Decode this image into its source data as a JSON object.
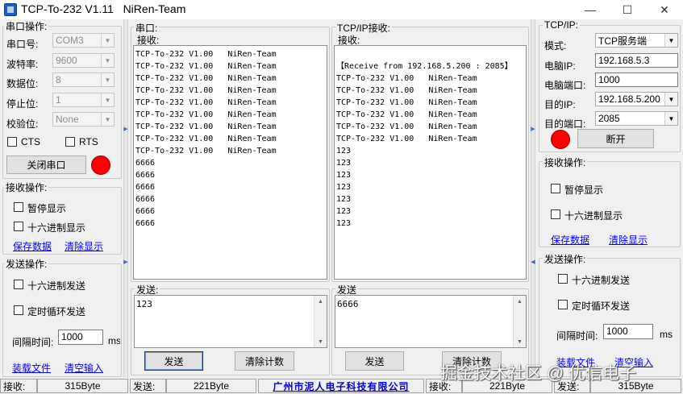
{
  "window": {
    "title": "TCP-To-232 V1.11   NiRen-Team",
    "min": "—",
    "max": "☐",
    "close": "✕"
  },
  "serial": {
    "group_label": "串口操作:",
    "port_label": "串口号:",
    "port_value": "COM3",
    "baud_label": "波特率:",
    "baud_value": "9600",
    "databits_label": "数据位:",
    "databits_value": "8",
    "stopbits_label": "停止位:",
    "stopbits_value": "1",
    "parity_label": "校验位:",
    "parity_value": "None",
    "cts_label": "CTS",
    "rts_label": "RTS",
    "close_port": "关闭串口"
  },
  "recv_ops_left": {
    "group_label": "接收操作:",
    "pause": "暂停显示",
    "hex_display": "十六进制显示",
    "save": "保存数据",
    "clear": "清除显示"
  },
  "send_ops_left": {
    "group_label": "发送操作:",
    "hex_send": "十六进制发送",
    "timed_send": "定时循环发送",
    "interval_label": "间隔时间:",
    "interval_value": "1000",
    "ms": "ms",
    "load_file": "装载文件",
    "clear_input": "清空输入"
  },
  "serial_pane": {
    "title": "串口:",
    "recv_label": "接收:",
    "recv_text": "TCP-To-232 V1.00   NiRen-Team\nTCP-To-232 V1.00   NiRen-Team\nTCP-To-232 V1.00   NiRen-Team\nTCP-To-232 V1.00   NiRen-Team\nTCP-To-232 V1.00   NiRen-Team\nTCP-To-232 V1.00   NiRen-Team\nTCP-To-232 V1.00   NiRen-Team\nTCP-To-232 V1.00   NiRen-Team\nTCP-To-232 V1.00   NiRen-Team\n6666\n6666\n6666\n6666\n6666\n6666",
    "send_label": "发送:",
    "send_text": "123",
    "send_btn": "发送",
    "clear_count_btn": "清除计数"
  },
  "tcp_pane": {
    "title": "TCP/IP接收:",
    "recv_label": "接收:",
    "recv_text": "\n【Receive from 192.168.5.200 : 2085】\nTCP-To-232 V1.00   NiRen-Team\nTCP-To-232 V1.00   NiRen-Team\nTCP-To-232 V1.00   NiRen-Team\nTCP-To-232 V1.00   NiRen-Team\nTCP-To-232 V1.00   NiRen-Team\nTCP-To-232 V1.00   NiRen-Team\n123\n123\n123\n123\n123\n123\n123",
    "send_label": "发送",
    "send_text": "6666",
    "send_btn": "发送",
    "clear_count_btn": "清除计数"
  },
  "tcpip": {
    "group_label": "TCP/IP:",
    "mode_label": "模式:",
    "mode_value": "TCP服务端",
    "pc_ip_label": "电脑IP:",
    "pc_ip_value": "192.168.5.3",
    "pc_port_label": "电脑端口:",
    "pc_port_value": "1000",
    "dest_ip_label": "目的IP:",
    "dest_ip_value": "192.168.5.200",
    "dest_port_label": "目的端口:",
    "dest_port_value": "2085",
    "disconnect": "断开"
  },
  "recv_ops_right": {
    "group_label": "接收操作:",
    "pause": "暂停显示",
    "hex_display": "十六进制显示",
    "save": "保存数据",
    "clear": "清除显示"
  },
  "send_ops_right": {
    "group_label": "发送操作:",
    "hex_send": "十六进制发送",
    "timed_send": "定时循环发送",
    "interval_label": "间隔时间:",
    "interval_value": "1000",
    "ms": "ms",
    "load_file": "装载文件",
    "clear_input": "清空输入"
  },
  "status": {
    "recv1_label": "接收:",
    "recv1_value": "315Byte",
    "send1_label": "发送:",
    "send1_value": "221Byte",
    "company": "广州市泥人电子科技有限公司",
    "recv2_label": "接收:",
    "recv2_value": "221Byte",
    "send2_label": "发送:",
    "send2_value": "315Byte"
  },
  "watermark": "掘金技术社区 @ 优信电子",
  "colors": {
    "lamp": "#ff0000",
    "link": "#0000ff",
    "company": "#0000cc"
  }
}
